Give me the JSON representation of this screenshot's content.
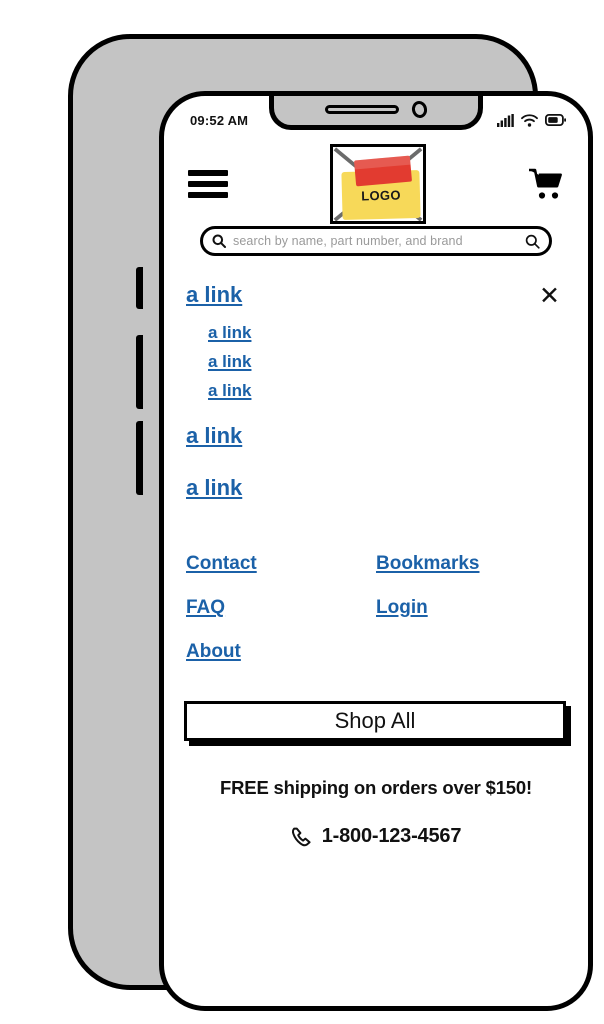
{
  "statusbar": {
    "time": "09:52 AM",
    "icons": [
      "signal-icon",
      "wifi-icon",
      "battery-icon"
    ]
  },
  "appbar": {
    "menu_icon": "hamburger-menu-icon",
    "cart_icon": "shopping-cart-icon",
    "logo": {
      "placeholder_icon": "image-placeholder-icon",
      "label": "LOGO"
    }
  },
  "search": {
    "placeholder": "search by name, part number, and brand",
    "value": "",
    "left_icon": "search-icon",
    "right_icon": "search-icon"
  },
  "nav": {
    "close_label": "✕",
    "primary": {
      "label": "a link"
    },
    "sub_items": [
      {
        "label": "a link"
      },
      {
        "label": "a link"
      },
      {
        "label": "a link"
      }
    ],
    "more_items": [
      {
        "label": "a link"
      },
      {
        "label": "a link"
      }
    ]
  },
  "footer_links": [
    {
      "label": "Contact"
    },
    {
      "label": "Bookmarks"
    },
    {
      "label": "FAQ"
    },
    {
      "label": "Login"
    },
    {
      "label": "About"
    }
  ],
  "cta": {
    "shop_all_label": "Shop All"
  },
  "promo": {
    "shipping_text": "FREE shipping on orders over $150!",
    "phone_icon": "phone-icon",
    "phone_number": "1-800-123-4567"
  },
  "colors": {
    "link_blue": "#1b61a8",
    "sticky_yellow": "#f7d959",
    "tape_red": "#e23b30",
    "bezel_gray": "#c4c4c4",
    "outline_black": "#000000"
  }
}
